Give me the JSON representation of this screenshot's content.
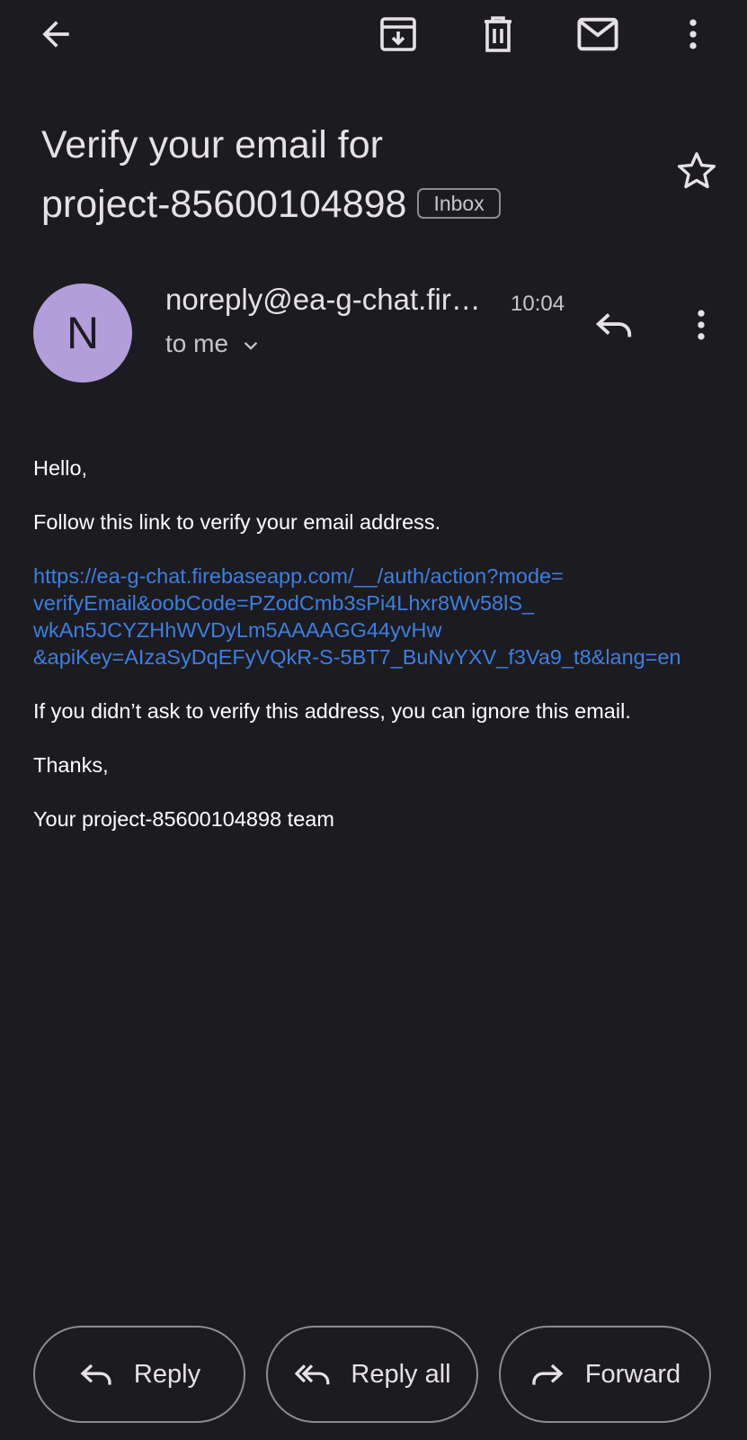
{
  "toolbar": {
    "back_icon": "arrow-back-icon",
    "archive_icon": "archive-icon",
    "delete_icon": "delete-icon",
    "mark_unread_icon": "mail-icon",
    "more_icon": "more-vert-icon"
  },
  "subject": {
    "line1": "Verify your email for",
    "line2": "project-85600104898",
    "label": "Inbox",
    "star_icon": "star-outline-icon"
  },
  "message": {
    "avatar_letter": "N",
    "avatar_color": "#b39ddb",
    "sender": "noreply@ea-g-chat.fir…",
    "time": "10:04",
    "recipient_summary": "to me",
    "reply_icon": "reply-icon",
    "more_icon": "more-vert-icon"
  },
  "body": {
    "greeting": "Hello,",
    "instruction": "Follow this link to verify your email address.",
    "link_lines": [
      "https://ea-g-chat.firebaseapp.com/__/auth/action?mode=",
      "verifyEmail&oobCode=PZodCmb3sPi4Lhxr8Wv58lS_",
      "wkAn5JCYZHhWVDyLm5AAAAGG44yvHw",
      "&apiKey=AIzaSyDqEFyVQkR-S-5BT7_BuNvYXV_f3Va9_t8&lang=en"
    ],
    "link_color": "#3d7fe0",
    "ignore_note": "If you didn’t ask to verify this address, you can ignore this email.",
    "signoff": "Thanks,",
    "signature": "Your project-85600104898 team"
  },
  "actions": {
    "reply_label": "Reply",
    "reply_all_label": "Reply all",
    "forward_label": "Forward"
  },
  "colors": {
    "background": "#1c1b20",
    "text": "#e6e1e5",
    "outline": "#8e8b93"
  }
}
